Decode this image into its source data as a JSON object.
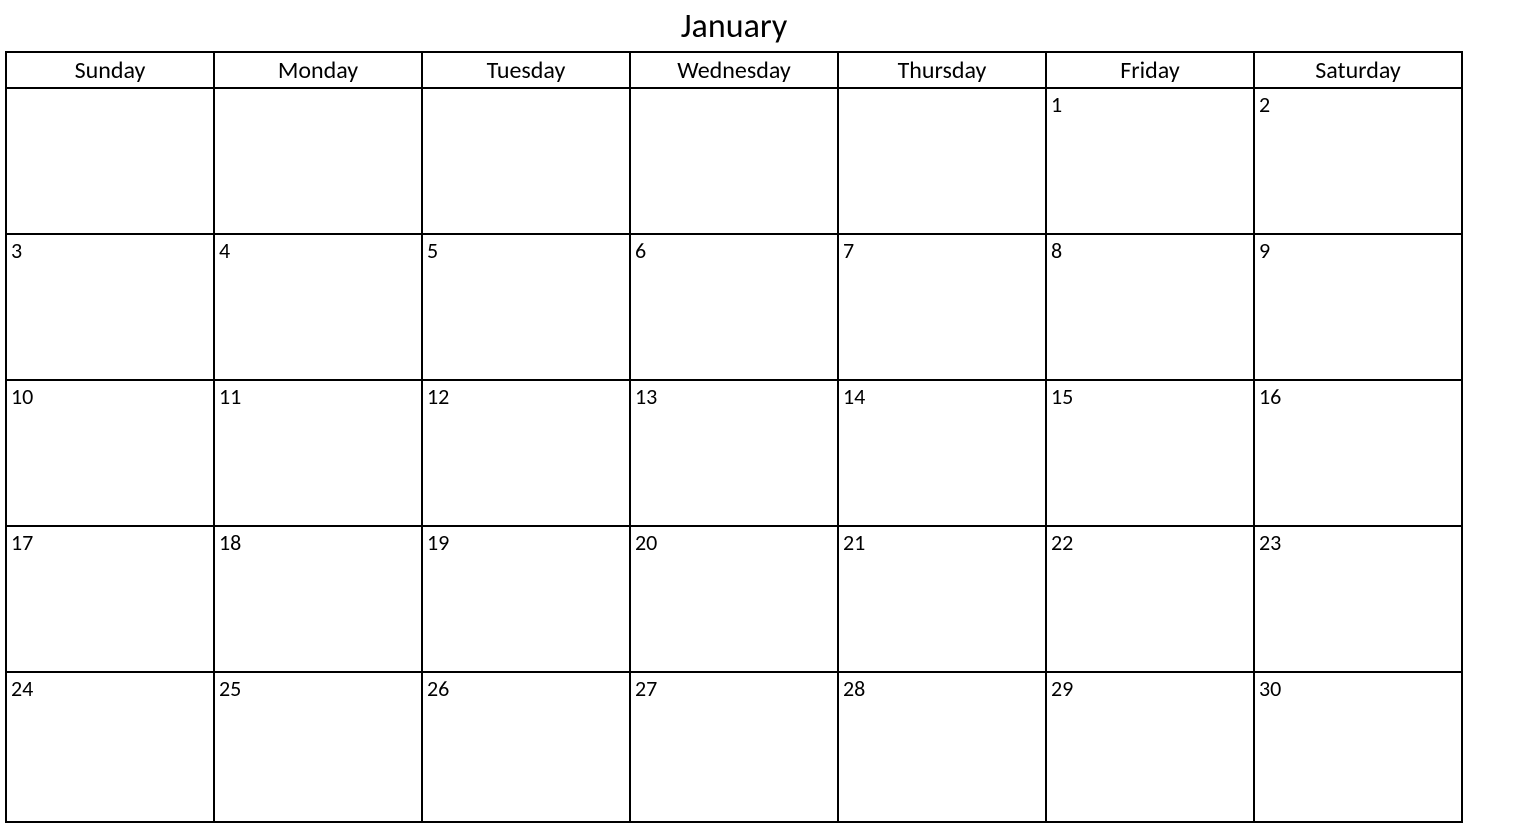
{
  "calendar": {
    "month_title": "January",
    "day_headers": [
      "Sunday",
      "Monday",
      "Tuesday",
      "Wednesday",
      "Thursday",
      "Friday",
      "Saturday"
    ],
    "weeks": [
      [
        "",
        "",
        "",
        "",
        "",
        "1",
        "2"
      ],
      [
        "3",
        "4",
        "5",
        "6",
        "7",
        "8",
        "9"
      ],
      [
        "10",
        "11",
        "12",
        "13",
        "14",
        "15",
        "16"
      ],
      [
        "17",
        "18",
        "19",
        "20",
        "21",
        "22",
        "23"
      ],
      [
        "24",
        "25",
        "26",
        "27",
        "28",
        "29",
        "30"
      ]
    ]
  }
}
